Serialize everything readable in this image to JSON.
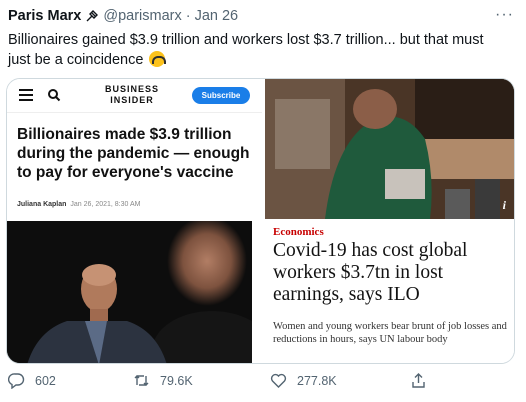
{
  "tweet": {
    "author_name": "Paris Marx",
    "handle": "@parismarx",
    "separator": "·",
    "date": "Jan 26",
    "more_label": "···",
    "text": "Billionaires gained $3.9 trillion and workers lost $3.7 trillion... but that must just be a coincidence"
  },
  "business_insider": {
    "logo_line1": "BUSINESS",
    "logo_line2": "INSIDER",
    "subscribe_label": "Subscribe",
    "headline": "Billionaires made $3.9 trillion during the pandemic — enough to pay for everyone's vaccine",
    "author": "Juliana Kaplan",
    "timestamp": "Jan 26, 2021, 8:30 AM"
  },
  "guardian": {
    "photo_badge": "i",
    "section": "Economics",
    "headline": "Covid-19 has cost global workers $3.7tn in lost earnings, says ILO",
    "standfirst": "Women and young workers bear brunt of job losses and reductions in hours, says UN labour body"
  },
  "actions": {
    "replies": "602",
    "retweets": "79.6K",
    "likes": "277.8K"
  },
  "colors": {
    "accent": "#1d9bf0",
    "subscribe_bg": "#1a7ee8",
    "guardian_red": "#c70000",
    "muted": "#536471"
  }
}
